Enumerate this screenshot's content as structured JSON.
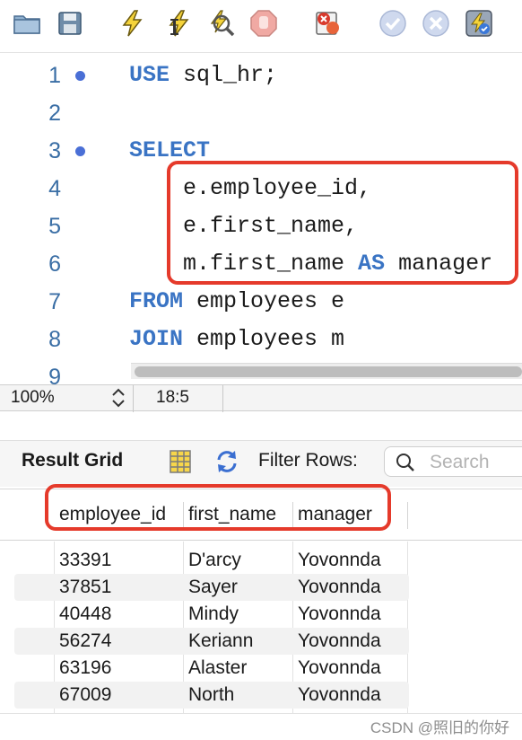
{
  "toolbar": {
    "icons": [
      "open-folder-icon",
      "save-icon",
      "execute-icon",
      "execute-current-icon",
      "explain-icon",
      "stop-icon",
      "toggle-error-icon",
      "commit-icon",
      "rollback-icon",
      "autocommit-icon"
    ]
  },
  "editor": {
    "lines": [
      {
        "num": "1",
        "text": "USE sql_hr;"
      },
      {
        "num": "2",
        "text": ""
      },
      {
        "num": "3",
        "text": "SELECT"
      },
      {
        "num": "4",
        "text": "    e.employee_id,"
      },
      {
        "num": "5",
        "text": "    e.first_name,"
      },
      {
        "num": "6",
        "text": "    m.first_name AS manager"
      },
      {
        "num": "7",
        "text": "FROM employees e"
      },
      {
        "num": "8",
        "text": "JOIN employees m"
      },
      {
        "num": "9",
        "text": ""
      }
    ]
  },
  "status": {
    "zoom": "100%",
    "cursor": "18:5"
  },
  "results": {
    "title": "Result Grid",
    "filter_label": "Filter Rows:",
    "search_placeholder": "Search",
    "columns": [
      "employee_id",
      "first_name",
      "manager"
    ],
    "rows": [
      [
        "33391",
        "D'arcy",
        "Yovonnda"
      ],
      [
        "37851",
        "Sayer",
        "Yovonnda"
      ],
      [
        "40448",
        "Mindy",
        "Yovonnda"
      ],
      [
        "56274",
        "Keriann",
        "Yovonnda"
      ],
      [
        "63196",
        "Alaster",
        "Yovonnda"
      ],
      [
        "67009",
        "North",
        "Yovonnda"
      ]
    ]
  },
  "watermark": "CSDN @照旧的你好",
  "colors": {
    "keyword": "#3a74c4",
    "highlight": "#e53a2b",
    "line_number": "#3a6ea5"
  }
}
